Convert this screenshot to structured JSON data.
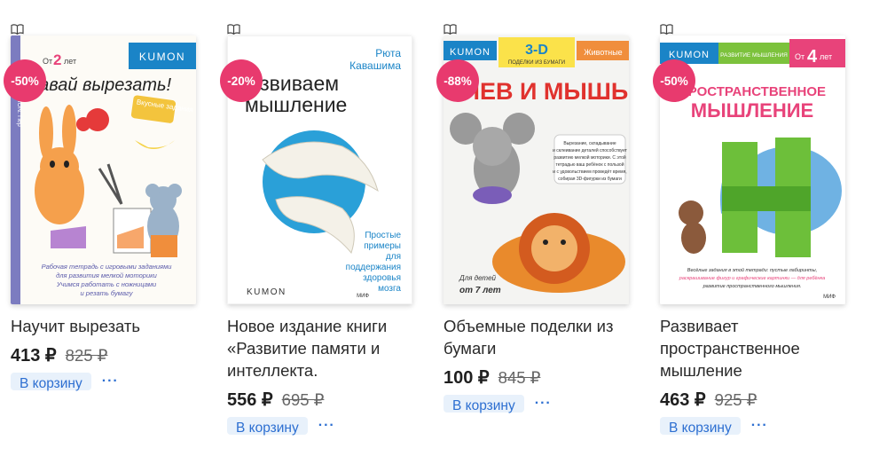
{
  "products": [
    {
      "title": "Научит вырезать",
      "price": "413 ₽",
      "old_price": "825 ₽",
      "discount": "-50%",
      "cart_label": "В корзину",
      "more_label": "···",
      "cover": {
        "brand": "KUMON",
        "age_prefix": "От",
        "age_num": "2",
        "age_suffix": "лет",
        "headline": "Давай вырезать!",
        "sticker": "Вкусные задания",
        "spine": "KUMON. Пер",
        "caption1": "Рабочая тетрадь с игровыми заданиями",
        "caption2": "для развития мелкой моторики",
        "caption3": "Учимся работать с ножницами",
        "caption4": "и резать бумагу"
      }
    },
    {
      "title": "Новое издание книги «Развитие памяти и интеллекта.",
      "price": "556 ₽",
      "old_price": "695 ₽",
      "discount": "-20%",
      "cart_label": "В корзину",
      "more_label": "···",
      "cover": {
        "author1": "Рюта",
        "author2": "Кавашима",
        "headline1": "Развиваем",
        "headline2": "мышление",
        "sub1": "Простые",
        "sub2": "примеры",
        "sub3": "для",
        "sub4": "поддержания",
        "sub5": "здоровья",
        "sub6": "мозга",
        "brand": "KUMON",
        "publisher": "МИФ"
      }
    },
    {
      "title": "Объемные поделки из бумаги",
      "price": "100 ₽",
      "old_price": "845 ₽",
      "discount": "-88%",
      "cart_label": "В корзину",
      "more_label": "···",
      "cover": {
        "brand": "KUMON",
        "tag3d": "3-D",
        "tag3d_sub": "ПОДЕЛКИ ИЗ БУМАГИ",
        "category": "Животные",
        "headline": "ЛЕВ И МЫШЬ",
        "blurb1": "Вырезание, складывание",
        "blurb2": "и склеивание деталей способствует",
        "blurb3": "развитию мелкой моторики. С этой",
        "blurb4": "тетрадью ваш ребёнок с пользой",
        "blurb5": "и с удовольствием проведёт время,",
        "blurb6": "собирая 3D-фигурки из бумаги",
        "age1": "Для детей",
        "age2": "от 7 лет"
      }
    },
    {
      "title": "Развивает пространственное мышление",
      "price": "463 ₽",
      "old_price": "925 ₽",
      "discount": "-50%",
      "cart_label": "В корзину",
      "more_label": "···",
      "cover": {
        "brand": "KUMON",
        "category": "РАЗВИТИЕ МЫШЛЕНИЯ",
        "age_prefix": "От",
        "age_num": "4",
        "age_suffix": "лет",
        "headline1": "ПРОСТРАНСТВЕННОЕ",
        "headline2": "МЫШЛЕНИЕ",
        "caption1": "Весёлые задания в этой тетради: пустые лабиринты,",
        "caption2": "раскрашивание фигур и графические картинки — для ребёнка",
        "caption3": "развитие пространственного мышления.",
        "publisher": "МИФ"
      }
    }
  ],
  "colors": {
    "badge": "#e83a6e",
    "cart_bg": "#e8f1fb",
    "cart_text": "#2d6fd1",
    "kumon_blue": "#1a84c7"
  },
  "icons": {
    "book_icon": "open-book"
  }
}
